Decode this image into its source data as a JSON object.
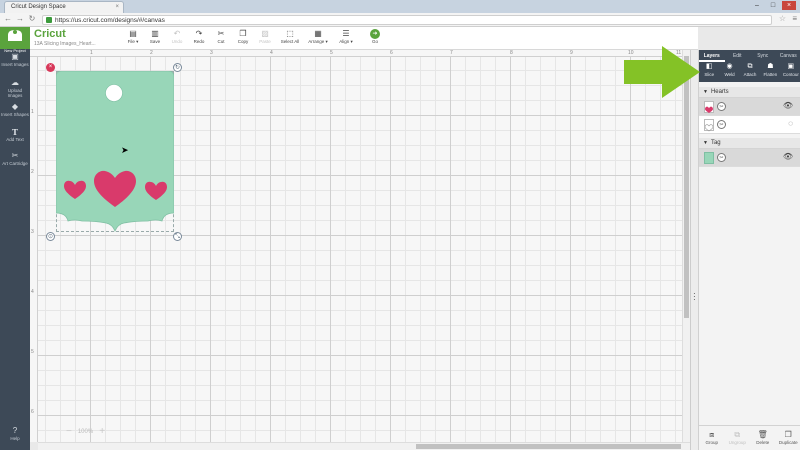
{
  "browser": {
    "tab_title": "Cricut Design Space",
    "tab_close": "×",
    "url": "https://us.cricut.com/designs/#/canvas",
    "window_controls": [
      "–",
      "□",
      "×"
    ]
  },
  "sidebar": {
    "new_label": "New Project",
    "items": [
      {
        "label": "Insert Images",
        "icon": "image-icon"
      },
      {
        "label": "Upload Images",
        "icon": "upload-icon"
      },
      {
        "label": "Insert Shapes",
        "icon": "shapes-icon"
      },
      {
        "label": "Add Text",
        "icon": "text-icon"
      },
      {
        "label": "Art Cartridge",
        "icon": "cartridge-icon"
      }
    ],
    "help_label": "Help"
  },
  "toolbar": {
    "logo": "Cricut",
    "project_name": "13A Slicing Images_Heart...",
    "buttons": [
      {
        "label": "File ▾",
        "icon": "folder-icon",
        "enabled": true
      },
      {
        "label": "Save",
        "icon": "save-icon",
        "enabled": true
      },
      {
        "label": "Undo",
        "icon": "undo-icon",
        "enabled": false
      },
      {
        "label": "Redo",
        "icon": "redo-icon",
        "enabled": true
      },
      {
        "label": "Cut",
        "icon": "scissors-icon",
        "enabled": true
      },
      {
        "label": "Copy",
        "icon": "copy-icon",
        "enabled": true
      },
      {
        "label": "Paste",
        "icon": "paste-icon",
        "enabled": false
      },
      {
        "label": "Select All",
        "icon": "select-all-icon",
        "enabled": true
      },
      {
        "label": "Arrange ▾",
        "icon": "arrange-icon",
        "enabled": true
      },
      {
        "label": "Align ▾",
        "icon": "align-icon",
        "enabled": true
      }
    ],
    "go_label": "Go"
  },
  "canvas": {
    "ruler_top": [
      "1",
      "2",
      "3",
      "4",
      "5",
      "6",
      "7",
      "8",
      "9",
      "10",
      "11"
    ],
    "ruler_left": [
      "1",
      "2",
      "3",
      "4",
      "5",
      "6"
    ],
    "zoom_value": "100%",
    "zoom_out": "−",
    "zoom_in": "+"
  },
  "panel": {
    "tabs": [
      {
        "label": "Layers",
        "active": true
      },
      {
        "label": "Edit",
        "active": false
      },
      {
        "label": "Sync",
        "active": false
      },
      {
        "label": "Canvas",
        "active": false
      }
    ],
    "tools": [
      {
        "label": "Slice",
        "icon": "slice-icon"
      },
      {
        "label": "Weld",
        "icon": "weld-icon"
      },
      {
        "label": "Attach",
        "icon": "attach-icon"
      },
      {
        "label": "Flatten",
        "icon": "flatten-icon"
      },
      {
        "label": "Contour",
        "icon": "contour-icon"
      }
    ],
    "groups": [
      {
        "name": "Hearts"
      },
      {
        "name": "Tag"
      }
    ],
    "bottom": [
      {
        "label": "Group",
        "icon": "group-icon",
        "enabled": true
      },
      {
        "label": "Ungroup",
        "icon": "ungroup-icon",
        "enabled": false
      },
      {
        "label": "Delete",
        "icon": "trash-icon",
        "enabled": true
      },
      {
        "label": "Duplicate",
        "icon": "duplicate-icon",
        "enabled": true
      }
    ]
  },
  "colors": {
    "tag": "#98d6b8",
    "hearts": "#d93a6b",
    "cricut_green": "#5aa33d",
    "sidebar": "#3d4957",
    "arrow": "#84c226"
  }
}
